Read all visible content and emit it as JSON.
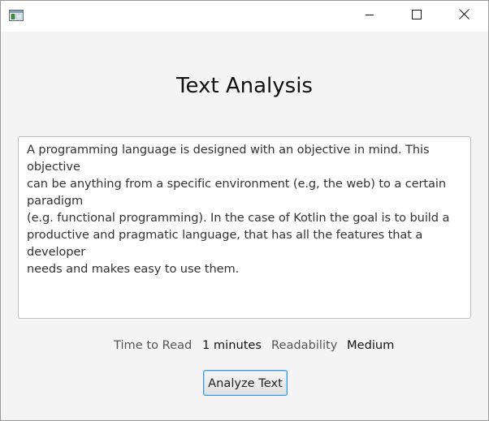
{
  "titlebar": {
    "icon": "app-window-icon",
    "buttons": {
      "minimize": "minimize-icon",
      "maximize": "maximize-icon",
      "close": "close-icon"
    }
  },
  "main": {
    "title": "Text Analysis",
    "textarea_value": "A programming language is designed with an objective in mind. This objective can be anything from a specific environment (e.g, the web) to a certain paradigm (e.g. functional programming). In the case of Kotlin the goal is to build a productive and pragmatic language, that has all the features that a developer needs and makes easy to use them.",
    "textarea_lines": [
      "A programming language is designed with an objective in mind. This objective",
      "can be anything from a specific environment (e.g, the web) to a certain paradigm",
      "(e.g. functional programming). In the case of Kotlin the goal is to build a",
      "productive and pragmatic language, that has all the features that a developer",
      "needs and makes easy to use them."
    ],
    "stats": {
      "time_to_read_label": "Time to Read",
      "time_to_read_value": "1 minutes",
      "readability_label": "Readability",
      "readability_value": "Medium"
    },
    "analyze_button_label": "Analyze Text"
  },
  "colors": {
    "window_bg": "#f4f4f4",
    "titlebar_bg": "#ffffff",
    "button_focus_border": "#3c9ad8"
  }
}
